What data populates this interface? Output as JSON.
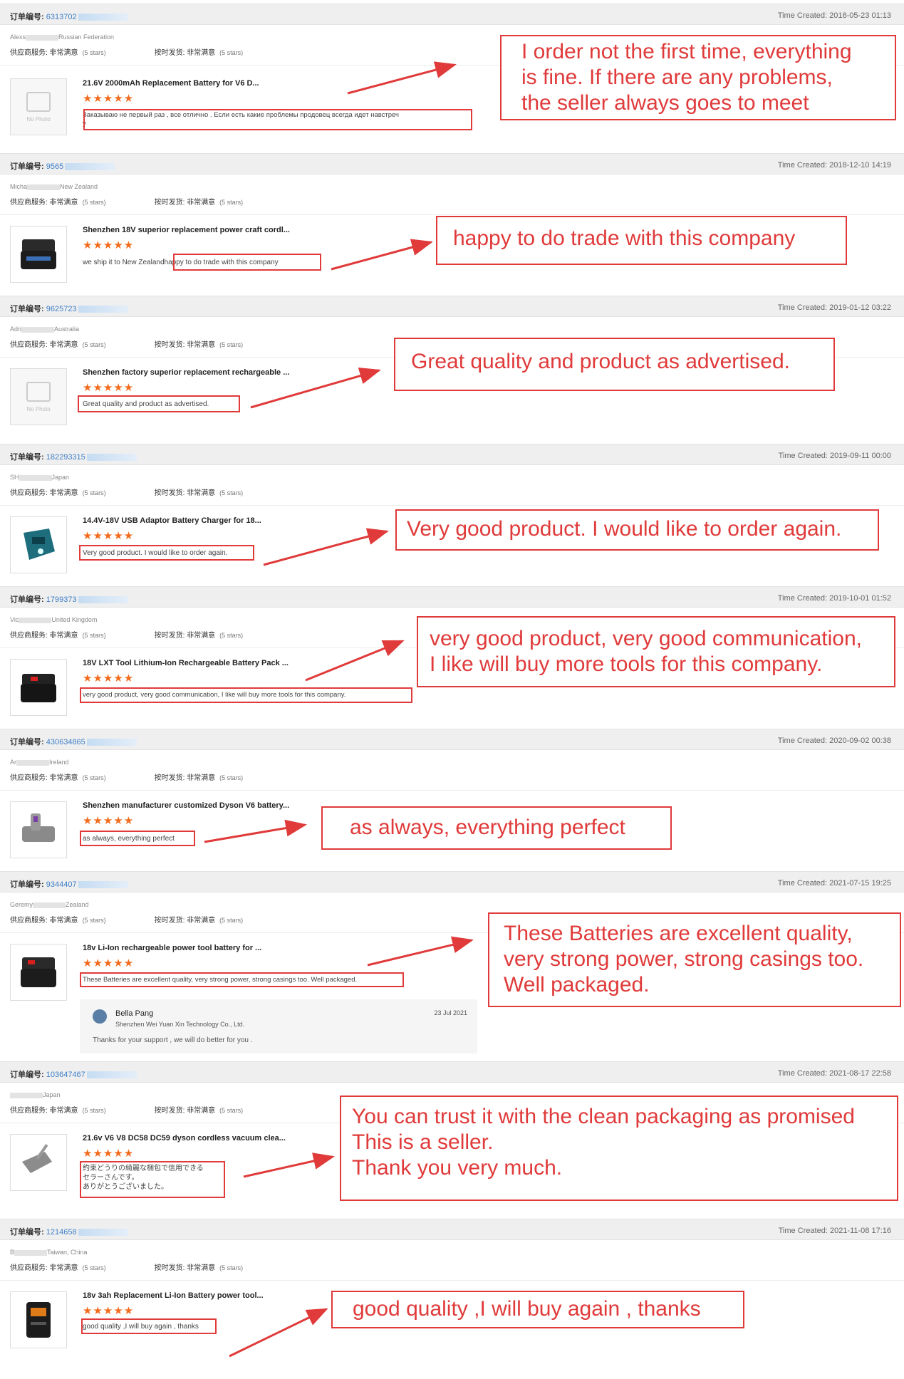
{
  "labels": {
    "order_prefix": "订单编号:",
    "time_prefix": "Time Created:",
    "supplier_service": "供应商服务: 非常满意",
    "on_time_shipping": "按时发货: 非常满意",
    "five_stars": "(5 stars)",
    "stars": "★★★★★",
    "no_photo": "No Photo"
  },
  "colors": {
    "accent_red": "#e03a3a",
    "star_orange": "#f26a1b",
    "link_blue": "#3d7fc8",
    "header_gray": "#efefef"
  },
  "orders": [
    {
      "order_no": "6313702",
      "time": "2018-05-23 01:13",
      "buyer": "Alexs",
      "country": "Russian Federation",
      "image": "no-photo",
      "product": "21.6V 2000mAh Replacement Battery for V6 D...",
      "review": "Заказываю не первый раз , все отлично . Если есть какие проблемы продовец всегда идет навстреч",
      "review_line2": "у",
      "callout": [
        "I order not the first time, everything",
        "is fine. If there are any problems,",
        "the seller always  goes to meet"
      ]
    },
    {
      "order_no": "9565",
      "time": "2018-12-10 14:19",
      "buyer": "Micha",
      "country": "New Zealand",
      "image": "battery-icon",
      "product": "Shenzhen 18V superior replacement power craft cordl...",
      "review_pre": "we ship it to New Zealand",
      "review": "happy to do trade with this company",
      "callout": [
        "happy to do trade with this company"
      ]
    },
    {
      "order_no": "9625723",
      "time": "2019-01-12 03:22",
      "buyer": "Adri",
      "country": "Australia",
      "image": "no-photo",
      "product": "Shenzhen factory superior replacement rechargeable ...",
      "review": "Great quality and product as advertised.",
      "callout": [
        "Great quality and product as advertised."
      ]
    },
    {
      "order_no": "182293315",
      "time": "2019-09-11 00:00",
      "buyer": "SH",
      "country": "Japan",
      "image": "charger-icon",
      "product": "14.4V-18V USB Adaptor Battery Charger for 18...",
      "review": "Very good product. I would like to order again.",
      "callout": [
        "Very good product. I would like to order again."
      ]
    },
    {
      "order_no": "1799373",
      "time": "2019-10-01 01:52",
      "buyer": "Vic",
      "country": "United Kingdom",
      "image": "battery-icon",
      "product": "18V LXT Tool Lithium-Ion Rechargeable Battery Pack ...",
      "review": "very good product, very good communication, I like will buy more tools for this company.",
      "callout": [
        "very good product, very good communication,",
        "I like will buy more tools for this company."
      ]
    },
    {
      "order_no": "430634865",
      "time": "2020-09-02 00:38",
      "buyer": "Ar",
      "country": "Ireland",
      "image": "dyson-battery-icon",
      "product": "Shenzhen manufacturer customized Dyson V6 battery...",
      "review": "as always, everything perfect",
      "callout": [
        "as always, everything perfect"
      ]
    },
    {
      "order_no": "9344407",
      "time": "2021-07-15 19:25",
      "buyer": "Geremy",
      "country": "Zealand",
      "image": "battery-icon",
      "product": "18v Li-Ion rechargeable power tool battery for ...",
      "review": "These Batteries are excellent quality, very strong power, strong casings too.  Well packaged.",
      "callout": [
        "These Batteries are excellent quality,",
        "very strong power, strong casings too.",
        "Well packaged."
      ],
      "reply": {
        "name": "Bella Pang",
        "company": "Shenzhen Wei Yuan Xin Technology Co., Ltd.",
        "date": "23 Jul 2021",
        "text": "Thanks for your support , we will do better for you ."
      }
    },
    {
      "order_no": "103647467",
      "time": "2021-08-17 22:58",
      "buyer": "",
      "country": "Japan",
      "image": "vacuum-battery-icon",
      "product": "21.6v V6 V8 DC58 DC59 dyson cordless vacuum clea...",
      "review_lines": [
        "約束どうりの綺麗な梱包で信用できる",
        "セラーさんです。",
        "ありがとうございました。"
      ],
      "callout": [
        "You can trust it with the clean packaging as promised",
        "This is a seller.",
        "Thank you very much."
      ]
    },
    {
      "order_no": "1214658",
      "time": "2021-11-08 17:16",
      "buyer": "B",
      "country": "Taiwan, China",
      "image": "battery-icon",
      "product": "18v 3ah Replacement Li-Ion Battery power tool...",
      "review": "good quality ,I will buy again , thanks",
      "callout": [
        "good quality ,I will buy again , thanks"
      ]
    }
  ]
}
